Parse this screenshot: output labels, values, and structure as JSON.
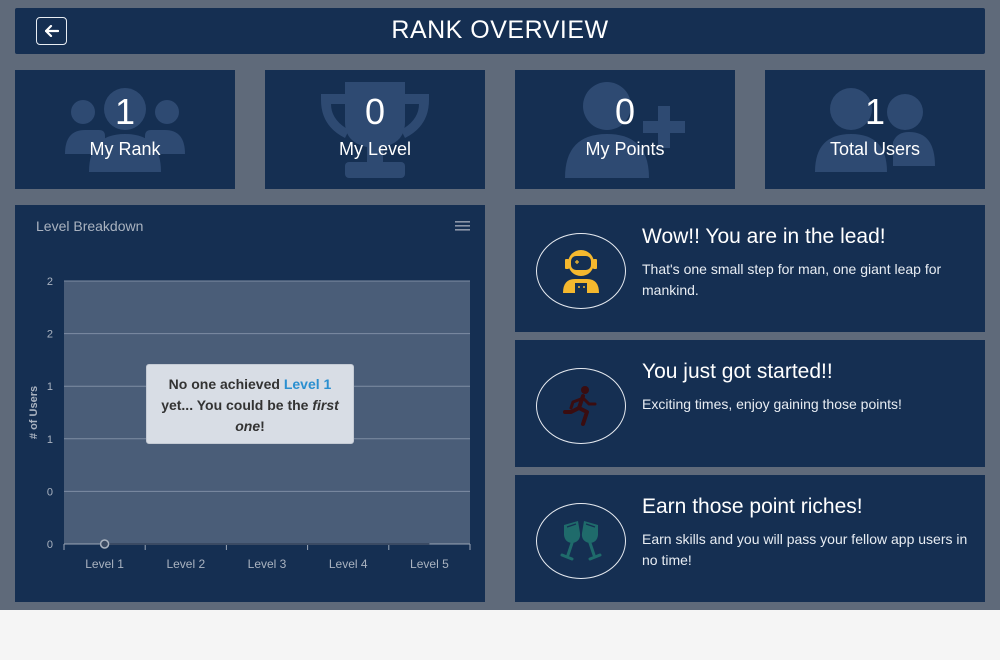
{
  "header": {
    "title": "RANK OVERVIEW",
    "back_icon": "arrow-left-icon"
  },
  "cards": [
    {
      "value": "1",
      "label": "My Rank",
      "icon": "users-group-icon"
    },
    {
      "value": "0",
      "label": "My Level",
      "icon": "trophy-icon"
    },
    {
      "value": "0",
      "label": "My Points",
      "icon": "user-plus-icon"
    },
    {
      "value": "1",
      "label": "Total Users",
      "icon": "user-friends-icon"
    }
  ],
  "chart_panel": {
    "title": "Level Breakdown",
    "menu_icon": "hamburger-menu-icon",
    "tooltip": {
      "line1_prefix": "No one achieved ",
      "line1_highlight": "Level 1",
      "line2": "yet... You could be the ",
      "line2_emphasis": "first",
      "line3_emphasis": "one",
      "line3_suffix": "!"
    }
  },
  "chart_data": {
    "type": "area",
    "categories": [
      "Level 1",
      "Level 2",
      "Level 3",
      "Level 4",
      "Level 5"
    ],
    "series": [
      {
        "values": [
          0,
          0,
          0,
          0,
          0
        ]
      }
    ],
    "ylabel": "# of Users",
    "y_tick_labels": [
      "0",
      "0",
      "1",
      "1",
      "2",
      "2"
    ],
    "ylim": [
      0,
      2
    ],
    "grid": true
  },
  "messages": [
    {
      "title": "Wow!! You are in the lead!",
      "text": "That's one small step for man, one giant leap for mankind.",
      "icon": "astronaut-icon",
      "icon_color": "#f5b82e"
    },
    {
      "title": "You just got started!!",
      "text": "Exciting times, enjoy gaining those points!",
      "icon": "running-person-icon",
      "icon_color": "#3a0d10"
    },
    {
      "title": "Earn those point riches!",
      "text": "Earn skills and you will pass your fellow app users in no time!",
      "icon": "cheers-glasses-icon",
      "icon_color": "#1f6b6b"
    }
  ],
  "colors": {
    "panel": "#152f52",
    "background": "#5f6a7a",
    "chart_plot": "#4a5d78",
    "highlight": "#2a8fd0"
  }
}
